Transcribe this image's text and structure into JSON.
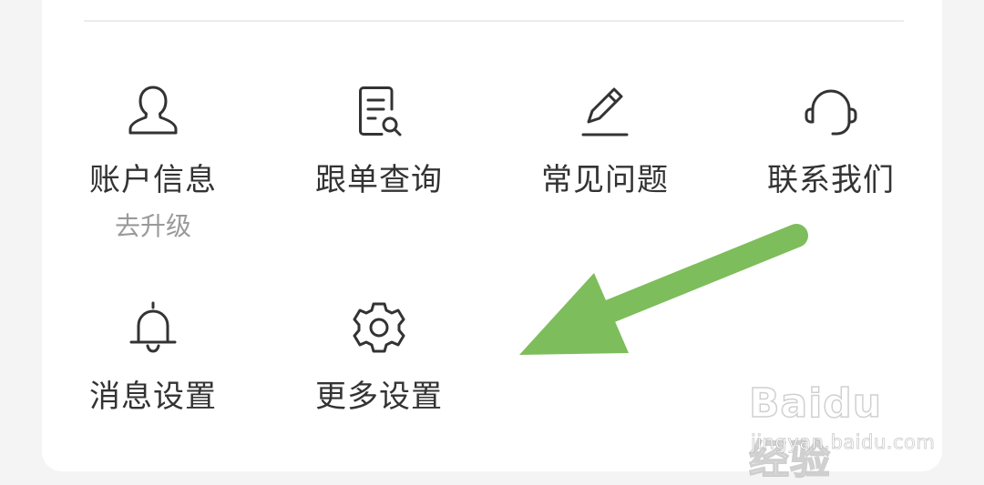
{
  "menu": {
    "items": [
      {
        "id": "account",
        "label": "账户信息",
        "sublabel": "去升级",
        "icon": "user-icon"
      },
      {
        "id": "track",
        "label": "跟单查询",
        "icon": "document-search-icon"
      },
      {
        "id": "faq",
        "label": "常见问题",
        "icon": "pencil-icon"
      },
      {
        "id": "contact",
        "label": "联系我们",
        "icon": "headset-icon"
      },
      {
        "id": "msg",
        "label": "消息设置",
        "icon": "bell-icon"
      },
      {
        "id": "more",
        "label": "更多设置",
        "icon": "gear-icon"
      }
    ]
  },
  "overlay": {
    "arrow_color": "#7dbd5b"
  },
  "watermark": {
    "brand": "Baidu 经验",
    "url": "jingyan.baidu.com"
  },
  "colors": {
    "background": "#f4f4f4",
    "card": "#ffffff",
    "text": "#333333",
    "subtext": "#9a9a9a"
  }
}
